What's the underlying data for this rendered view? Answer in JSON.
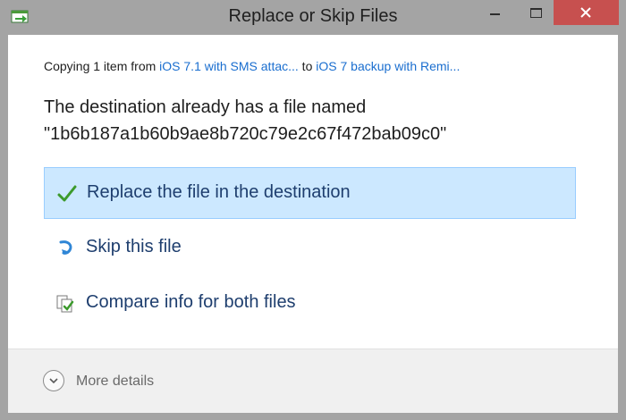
{
  "window": {
    "title": "Replace or Skip Files"
  },
  "dialog": {
    "copying_prefix": "Copying 1 item from ",
    "source_link": "iOS 7.1 with SMS attac...",
    "to_text": " to ",
    "destination_link": "iOS 7 backup with Remi...",
    "heading_line1": "The destination already has a file named",
    "heading_line2": "\"1b6b187a1b60b9ae8b720c79e2c67f472bab09c0\""
  },
  "options": [
    {
      "label": "Replace the file in the destination",
      "icon": "checkmark-icon",
      "selected": true
    },
    {
      "label": "Skip this file",
      "icon": "skip-arrow-icon",
      "selected": false
    },
    {
      "label": "Compare info for both files",
      "icon": "compare-files-icon",
      "selected": false
    }
  ],
  "footer": {
    "more_details_label": "More details",
    "icon": "chevron-down-icon"
  },
  "colors": {
    "accent_link": "#1a6ecf",
    "selected_bg": "#cce8ff",
    "close_red": "#c7504f",
    "frame_gray": "#a4a4a4"
  }
}
